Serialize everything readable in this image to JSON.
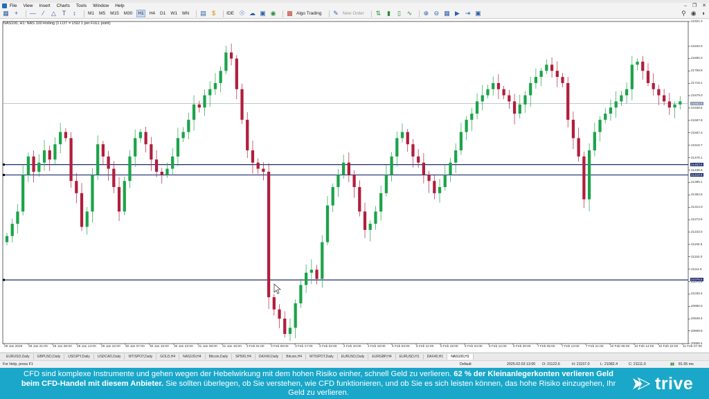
{
  "menu": {
    "items": [
      "File",
      "View",
      "Insert",
      "Charts",
      "Tools",
      "Window",
      "Help"
    ]
  },
  "toolbar": {
    "timeframes": [
      "M1",
      "M5",
      "M15",
      "M30",
      "H1",
      "H4",
      "D1",
      "W1",
      "MN"
    ],
    "active_timeframe": "H1",
    "ide_label": "IDE",
    "algo_trading_label": "Algo Trading",
    "new_order_label": "New Order"
  },
  "chart": {
    "header": "NAS100, H1:  NAS 100 Rolling (1 LOT = USD 1 per FULL point)",
    "price_labels": [
      "21921.3",
      "21840.0",
      "21800.3",
      "21759.8",
      "21719.1",
      "21679.0",
      "21638.5",
      "21597.8",
      "21557.3",
      "21516.7",
      "21476.1",
      "21435.6",
      "21395.1",
      "21354.6",
      "21314.0",
      "21273.5",
      "21233.0",
      "21192.5",
      "21152.0",
      "21111.5",
      "21070.9",
      "21030.4",
      "20990.0",
      "20949.4",
      "20909.9",
      "20868.4"
    ],
    "time_labels": [
      "28 Jan 2025",
      "29 Jan 21:00",
      "29 Jan 06:00",
      "29 Jan 14:00",
      "29 Jan 22:00",
      "30 Jan 07:00",
      "30 Jan 15:00",
      "30 Jan 23:00",
      "31 Jan 08:00",
      "31 Jan 16:00",
      "3 Feb 01:00",
      "3 Feb 09:00",
      "3 Feb 17:00",
      "4 Feb 02:00",
      "4 Feb 10:00",
      "4 Feb 18:00",
      "5 Feb 03:00",
      "5 Feb 11:00",
      "5 Feb 19:00",
      "6 Feb 04:00",
      "6 Feb 12:00",
      "6 Feb 20:00",
      "7 Feb 05:00",
      "7 Feb 13:00",
      "7 Feb 21:00",
      "10 Feb 06:00",
      "10 Feb 14:00",
      "10 Feb 22:00",
      "11 Feb 07:00"
    ],
    "levels": [
      "21453.5",
      "21419.6",
      "21076.5"
    ],
    "current_price": "21652.5",
    "colors": {
      "bull": "#1ca34a",
      "bear": "#b01e3c",
      "level": "#1c2a6e",
      "grid": "#e6e6e6"
    }
  },
  "chart_data": {
    "type": "candlestick",
    "symbol": "NAS100",
    "timeframe": "H1",
    "ylim": [
      20868.4,
      21921.3
    ],
    "levels": [
      21453.5,
      21419.6,
      21076.5
    ],
    "current_price": 21652.5,
    "closes": [
      21220,
      21260,
      21300,
      21420,
      21480,
      21430,
      21460,
      21500,
      21470,
      21520,
      21560,
      21540,
      21400,
      21360,
      21250,
      21300,
      21420,
      21520,
      21480,
      21440,
      21380,
      21300,
      21400,
      21480,
      21540,
      21560,
      21520,
      21470,
      21430,
      21420,
      21440,
      21480,
      21540,
      21560,
      21600,
      21650,
      21640,
      21680,
      21700,
      21720,
      21760,
      21820,
      21800,
      21700,
      21600,
      21500,
      21460,
      21440,
      21430,
      21020,
      20980,
      20950,
      20900,
      20920,
      21000,
      21060,
      21100,
      21110,
      21080,
      21200,
      21320,
      21380,
      21420,
      21460,
      21420,
      21380,
      21300,
      21240,
      21260,
      21300,
      21360,
      21420,
      21480,
      21540,
      21560,
      21520,
      21480,
      21460,
      21420,
      21400,
      21360,
      21380,
      21420,
      21460,
      21500,
      21560,
      21600,
      21620,
      21660,
      21680,
      21700,
      21720,
      21700,
      21680,
      21660,
      21620,
      21650,
      21680,
      21720,
      21740,
      21760,
      21780,
      21760,
      21740,
      21720,
      21600,
      21540,
      21480,
      21340,
      21500,
      21560,
      21600,
      21620,
      21640,
      21660,
      21680,
      21700,
      21780,
      21790,
      21760,
      21720,
      21700,
      21680,
      21660,
      21640,
      21650,
      21660
    ]
  },
  "tabs": [
    "EURUSD,Daily",
    "GBPUSD,Daily",
    "USDJPY,Daily",
    "USDCAD,Daily",
    "WTISPOT,Daily",
    "GOLD,H4",
    "NAS100,H4",
    "Bitcoin,Daily",
    "SP500,H4",
    "DAX40,Daily",
    "Bitcoin,H4",
    "WTISPOT,Daily",
    "EURUSD,Daily",
    "EURGBP,H4",
    "EURUSD,H1",
    "DAX40,H1",
    "NAS100,H1"
  ],
  "active_tab": "NAS100,H1",
  "status": {
    "help": "For Help, press F1",
    "profile": "Default",
    "datetime": "2025.02.03 13:00",
    "open": "O: 21122.6",
    "high": "H: 21157.0",
    "low": "L: 21082.4",
    "close": "C: 21111.0",
    "ping": "81.65 ms"
  },
  "disclaimer": {
    "part1": "CFD sind komplexe Instrumente und gehen wegen der Hebelwirkung mit dem hohen Risiko einher, schnell Geld zu verlieren.",
    "bold": "62 % der Kleinanlegerkonten verlieren Geld beim CFD-Handel mit diesem Anbieter.",
    "part2": "Sie sollten überlegen, ob Sie verstehen, wie CFD funktionieren, und ob Sie es sich leisten können, das hohe Risiko einzugehen, Ihr Geld zu verlieren."
  },
  "brand": {
    "logo_text": "trive"
  }
}
